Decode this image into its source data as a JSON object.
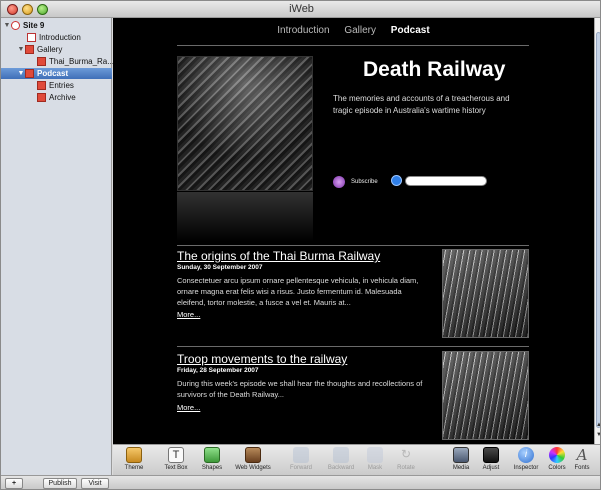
{
  "window": {
    "title": "iWeb"
  },
  "sidebar": {
    "items": [
      {
        "label": "Site 9",
        "expanded": true
      },
      {
        "label": "Introduction"
      },
      {
        "label": "Gallery",
        "expanded": true
      },
      {
        "label": "Thai_Burma_Ra..."
      },
      {
        "label": "Podcast",
        "expanded": true,
        "selected": true
      },
      {
        "label": "Entries"
      },
      {
        "label": "Archive"
      }
    ]
  },
  "page": {
    "nav": [
      "Introduction",
      "Gallery",
      "Podcast"
    ],
    "nav_current": "Podcast",
    "title": "Death Railway",
    "subtitle": "The memories and accounts of a treacherous and tragic episode in Australia's wartime history",
    "subscribe_label": "Subscribe",
    "posts": [
      {
        "title": "The origins of the Thai Burma Railway",
        "date": "Sunday, 30 September 2007",
        "body": "Consectetuer arcu ipsum ornare pellentesque vehicula, in vehicula diam, ornare magna erat felis wisi a risus. Justo fermentum id. Malesuada eleifend, tortor molestie, a fusce  a vel et. Mauris at...",
        "more": "More..."
      },
      {
        "title": "Troop movements to the railway",
        "date": "Friday, 28 September 2007",
        "body": "During this week's episode we shall hear the thoughts and recollections of survivors of the Death Railway...",
        "more": "More..."
      }
    ]
  },
  "toolbar": {
    "items": [
      {
        "label": "Theme",
        "icon": "theme-icon",
        "enabled": true
      },
      {
        "label": "Text Box",
        "icon": "text-box-icon",
        "enabled": true
      },
      {
        "label": "Shapes",
        "icon": "shapes-icon",
        "enabled": true
      },
      {
        "label": "Web Widgets",
        "icon": "web-widgets-icon",
        "enabled": true
      },
      {
        "label": "Forward",
        "icon": "forward-icon",
        "enabled": false
      },
      {
        "label": "Backward",
        "icon": "backward-icon",
        "enabled": false
      },
      {
        "label": "Mask",
        "icon": "mask-icon",
        "enabled": false
      },
      {
        "label": "Rotate",
        "icon": "rotate-icon",
        "enabled": false
      },
      {
        "label": "Media",
        "icon": "media-icon",
        "enabled": true
      },
      {
        "label": "Adjust",
        "icon": "adjust-icon",
        "enabled": true
      },
      {
        "label": "Inspector",
        "icon": "inspector-icon",
        "enabled": true
      },
      {
        "label": "Colors",
        "icon": "colors-icon",
        "enabled": true
      },
      {
        "label": "Fonts",
        "icon": "fonts-icon",
        "enabled": true
      }
    ]
  },
  "bottom": {
    "add_label": "+",
    "publish_label": "Publish",
    "visit_label": "Visit"
  },
  "colors": {
    "selection": "#3f6fb8",
    "canvas_bg": "#000000"
  }
}
